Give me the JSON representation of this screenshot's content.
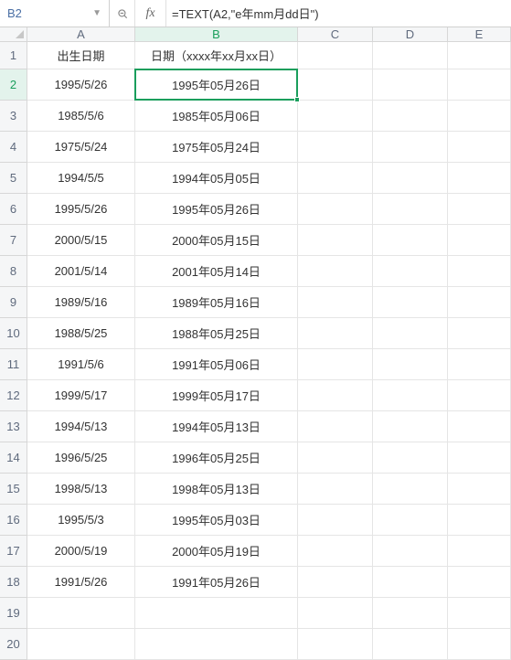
{
  "formula_bar": {
    "cell_ref": "B2",
    "formula": "=TEXT(A2,\"e年mm月dd日\")"
  },
  "columns": [
    "A",
    "B",
    "C",
    "D",
    "E"
  ],
  "active_col": "B",
  "active_row": 2,
  "rows": [
    {
      "n": 1,
      "a": "出生日期",
      "b": "日期（xxxx年xx月xx日）"
    },
    {
      "n": 2,
      "a": "1995/5/26",
      "b": "1995年05月26日"
    },
    {
      "n": 3,
      "a": "1985/5/6",
      "b": "1985年05月06日"
    },
    {
      "n": 4,
      "a": "1975/5/24",
      "b": "1975年05月24日"
    },
    {
      "n": 5,
      "a": "1994/5/5",
      "b": "1994年05月05日"
    },
    {
      "n": 6,
      "a": "1995/5/26",
      "b": "1995年05月26日"
    },
    {
      "n": 7,
      "a": "2000/5/15",
      "b": "2000年05月15日"
    },
    {
      "n": 8,
      "a": "2001/5/14",
      "b": "2001年05月14日"
    },
    {
      "n": 9,
      "a": "1989/5/16",
      "b": "1989年05月16日"
    },
    {
      "n": 10,
      "a": "1988/5/25",
      "b": "1988年05月25日"
    },
    {
      "n": 11,
      "a": "1991/5/6",
      "b": "1991年05月06日"
    },
    {
      "n": 12,
      "a": "1999/5/17",
      "b": "1999年05月17日"
    },
    {
      "n": 13,
      "a": "1994/5/13",
      "b": "1994年05月13日"
    },
    {
      "n": 14,
      "a": "1996/5/25",
      "b": "1996年05月25日"
    },
    {
      "n": 15,
      "a": "1998/5/13",
      "b": "1998年05月13日"
    },
    {
      "n": 16,
      "a": "1995/5/3",
      "b": "1995年05月03日"
    },
    {
      "n": 17,
      "a": "2000/5/19",
      "b": "2000年05月19日"
    },
    {
      "n": 18,
      "a": "1991/5/26",
      "b": "1991年05月26日"
    },
    {
      "n": 19,
      "a": "",
      "b": ""
    },
    {
      "n": 20,
      "a": "",
      "b": ""
    }
  ],
  "colors": {
    "accent": "#1a9e5c"
  }
}
